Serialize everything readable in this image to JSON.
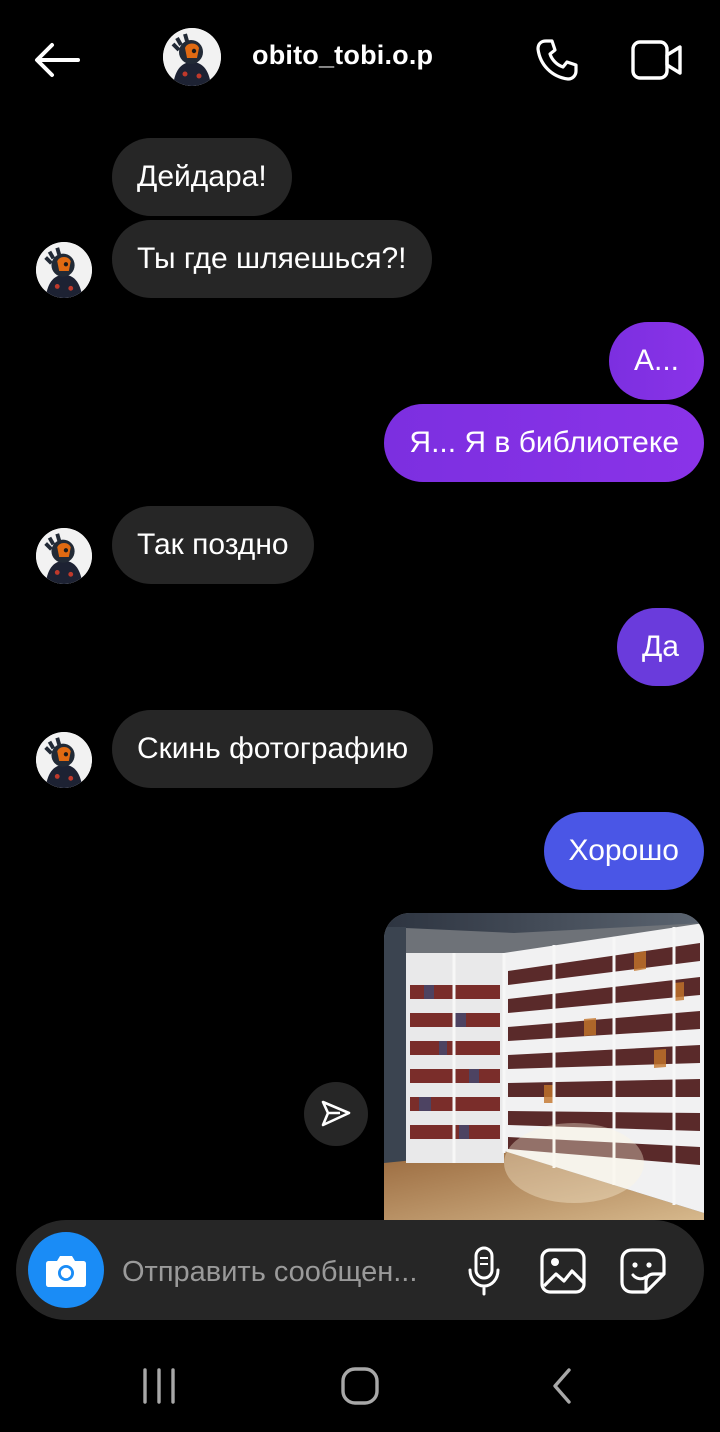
{
  "header": {
    "username": "obito_tobi.o.p",
    "back_icon": "arrow-left-icon",
    "call_icon": "phone-icon",
    "video_icon": "video-camera-icon"
  },
  "messages": [
    {
      "sender": "them",
      "text": "Дейдара!"
    },
    {
      "sender": "them",
      "text": "Ты где шляешься?!"
    },
    {
      "sender": "me",
      "text": "А..."
    },
    {
      "sender": "me",
      "text": "Я... Я в библиотеке"
    },
    {
      "sender": "them",
      "text": "Так поздно"
    },
    {
      "sender": "me",
      "text": "Да"
    },
    {
      "sender": "them",
      "text": "Скинь фотографию"
    },
    {
      "sender": "me",
      "text": "Хорошо"
    },
    {
      "sender": "me",
      "type": "photo",
      "subject": "library-bookshelves-photo"
    }
  ],
  "composer": {
    "placeholder": "Отправить сообщен...",
    "camera_icon": "camera-icon",
    "mic_icon": "microphone-icon",
    "gallery_icon": "gallery-icon",
    "sticker_icon": "sticker-icon"
  },
  "navigation": {
    "recents_icon": "recents-icon",
    "home_icon": "home-icon",
    "back_icon": "chevron-left-icon"
  },
  "colors": {
    "background": "#000000",
    "incoming_bubble": "#262626",
    "outgoing_purple": "#7c2fe0",
    "outgoing_violet": "#6a3bdc",
    "outgoing_blue": "#4a56e6",
    "camera_button": "#1a8cf6"
  }
}
